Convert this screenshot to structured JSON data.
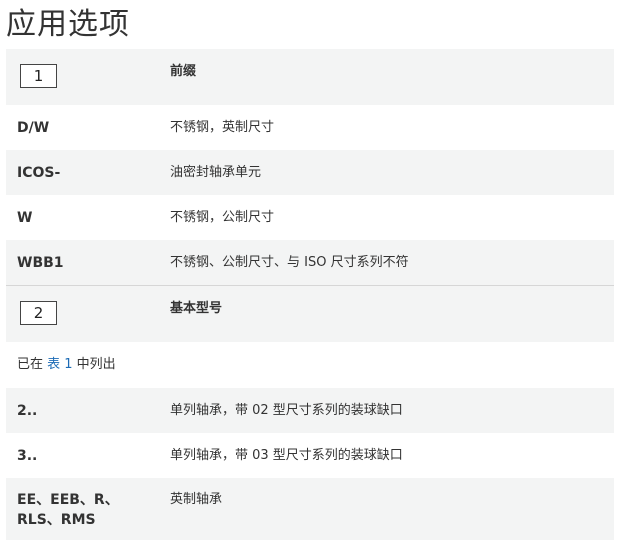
{
  "title": "应用选项",
  "sections": [
    {
      "number": "1",
      "heading": "前缀",
      "rows": [
        {
          "code": "D/W",
          "desc": "不锈钢，英制尺寸"
        },
        {
          "code": "ICOS-",
          "desc": "油密封轴承单元"
        },
        {
          "code": "W",
          "desc": "不锈钢，公制尺寸"
        },
        {
          "code": "WBB1",
          "desc": "不锈钢、公制尺寸、与 ISO 尺寸系列不符"
        }
      ]
    },
    {
      "number": "2",
      "heading": "基本型号",
      "note": {
        "prefix": "已在 ",
        "link": "表 1",
        "suffix": " 中列出"
      },
      "rows": [
        {
          "code": "2..",
          "desc": "单列轴承，带 02 型尺寸系列的装球缺口"
        },
        {
          "code": "3..",
          "desc": "单列轴承，带 03 型尺寸系列的装球缺口"
        },
        {
          "code_line1": "EE、EEB、R、",
          "code_line2": "RLS、RMS",
          "desc": "英制轴承"
        }
      ]
    }
  ]
}
